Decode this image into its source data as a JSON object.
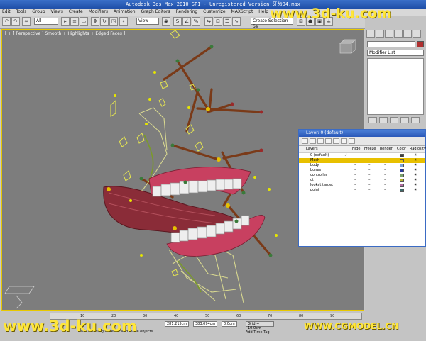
{
  "window": {
    "title": "Autodesk 3ds Max  2010 SP1  - Unregistered Version  牙齿04.max"
  },
  "menu": [
    "Edit",
    "Tools",
    "Group",
    "Views",
    "Create",
    "Modifiers",
    "Animation",
    "Graph Editors",
    "Rendering",
    "Customize",
    "MAXScript",
    "Help"
  ],
  "toolbar": {
    "filter_value": "All",
    "view_value": "View",
    "selection_set_placeholder": "Create Selection Se"
  },
  "viewport": {
    "label": "[ + ] Perspective ] Smooth + Highlights + Edged Faces ]"
  },
  "command_panel": {
    "modifier_list_label": "Modifier List"
  },
  "layer_dialog": {
    "title": "Layer: 0 (default)",
    "columns": [
      "Layers",
      "Hide",
      "Freeze",
      "Render",
      "Color",
      "Radiosity"
    ],
    "rows": [
      {
        "name": "0 (default)",
        "color": "#404040",
        "checked": true
      },
      {
        "name": "Mesh",
        "color": "#e8c000",
        "active": true
      },
      {
        "name": "body",
        "color": "#7aa0d8"
      },
      {
        "name": "bones",
        "color": "#2a3a9a"
      },
      {
        "name": "controller",
        "color": "#7aa06a"
      },
      {
        "name": "ct",
        "color": "#b8b030"
      },
      {
        "name": "lookat target",
        "color": "#b06aa0"
      },
      {
        "name": "point",
        "color": "#3c6a6a"
      }
    ]
  },
  "timeline": {
    "ticks": [
      "10",
      "20",
      "30",
      "40",
      "50",
      "60",
      "70",
      "80",
      "90"
    ]
  },
  "status": {
    "x_value": "281.215cm",
    "y_value": "383.094cm",
    "z_value": "0.0cm",
    "grid_value": "Grid = 10.0cm",
    "prompt": "Click and drag to select and move objects",
    "add_time_tag": "Add Time Tag"
  },
  "watermarks": {
    "top_right": "www.3d-ku.com",
    "bottom_left": "www.3d-ku.com",
    "bottom_right": "WWW.CGMODEL.CN"
  }
}
